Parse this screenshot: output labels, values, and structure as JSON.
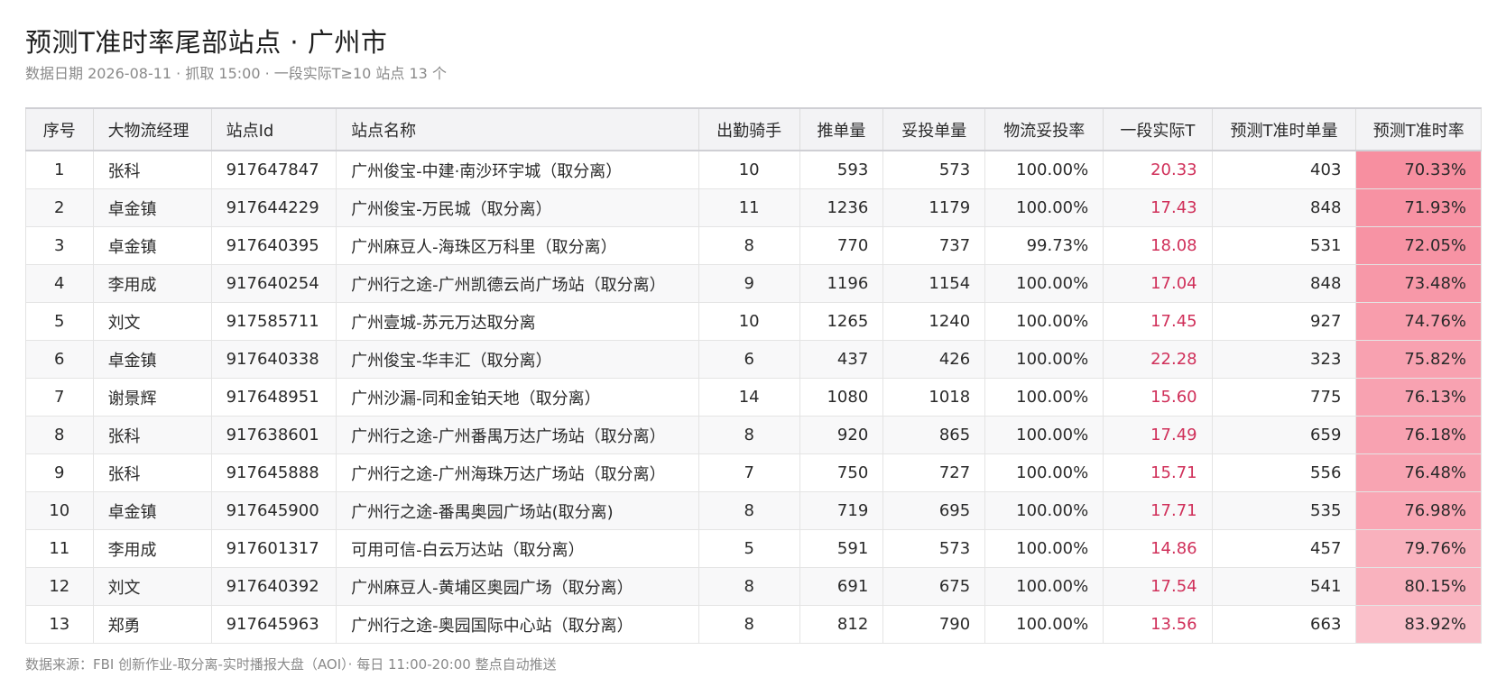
{
  "header": {
    "title": "预测T准时率尾部站点 · 广州市",
    "subtitle": "数据日期 2026-08-11 · 抓取 15:00 · 一段实际T≥10 站点 13 个"
  },
  "table": {
    "columns": [
      "序号",
      "大物流经理",
      "站点Id",
      "站点名称",
      "出勤骑手",
      "推单量",
      "妥投单量",
      "物流妥投率",
      "一段实际T",
      "预测T准时单量",
      "预测T准时率"
    ],
    "rows": [
      [
        "1",
        "张科",
        "917647847",
        "广州俊宝-中建·南沙环宇城（取分离）",
        "10",
        "593",
        "573",
        "100.00%",
        "20.33",
        "403",
        "70.33%"
      ],
      [
        "2",
        "卓金镇",
        "917644229",
        "广州俊宝-万民城（取分离）",
        "11",
        "1236",
        "1179",
        "100.00%",
        "17.43",
        "848",
        "71.93%"
      ],
      [
        "3",
        "卓金镇",
        "917640395",
        "广州麻豆人-海珠区万科里（取分离）",
        "8",
        "770",
        "737",
        "99.73%",
        "18.08",
        "531",
        "72.05%"
      ],
      [
        "4",
        "李用成",
        "917640254",
        "广州行之途-广州凯德云尚广场站（取分离）",
        "9",
        "1196",
        "1154",
        "100.00%",
        "17.04",
        "848",
        "73.48%"
      ],
      [
        "5",
        "刘文",
        "917585711",
        "广州壹城-苏元万达取分离",
        "10",
        "1265",
        "1240",
        "100.00%",
        "17.45",
        "927",
        "74.76%"
      ],
      [
        "6",
        "卓金镇",
        "917640338",
        "广州俊宝-华丰汇（取分离）",
        "6",
        "437",
        "426",
        "100.00%",
        "22.28",
        "323",
        "75.82%"
      ],
      [
        "7",
        "谢景辉",
        "917648951",
        "广州沙漏-同和金铂天地（取分离）",
        "14",
        "1080",
        "1018",
        "100.00%",
        "15.60",
        "775",
        "76.13%"
      ],
      [
        "8",
        "张科",
        "917638601",
        "广州行之途-广州番禺万达广场站（取分离）",
        "8",
        "920",
        "865",
        "100.00%",
        "17.49",
        "659",
        "76.18%"
      ],
      [
        "9",
        "张科",
        "917645888",
        "广州行之途-广州海珠万达广场站（取分离）",
        "7",
        "750",
        "727",
        "100.00%",
        "15.71",
        "556",
        "76.48%"
      ],
      [
        "10",
        "卓金镇",
        "917645900",
        "广州行之途-番禺奥园广场站(取分离)",
        "8",
        "719",
        "695",
        "100.00%",
        "17.71",
        "535",
        "76.98%"
      ],
      [
        "11",
        "李用成",
        "917601317",
        "可用可信-白云万达站（取分离）",
        "5",
        "591",
        "573",
        "100.00%",
        "14.86",
        "457",
        "79.76%"
      ],
      [
        "12",
        "刘文",
        "917640392",
        "广州麻豆人-黄埔区奥园广场（取分离）",
        "8",
        "691",
        "675",
        "100.00%",
        "17.54",
        "541",
        "80.15%"
      ],
      [
        "13",
        "郑勇",
        "917645963",
        "广州行之途-奥园国际中心站（取分离）",
        "8",
        "812",
        "790",
        "100.00%",
        "13.56",
        "663",
        "83.92%"
      ]
    ],
    "rate_colors": [
      "#f78fa0",
      "#f792a3",
      "#f793a4",
      "#f798a8",
      "#f89dac",
      "#f8a1b0",
      "#f8a2b1",
      "#f8a2b1",
      "#f8a4b2",
      "#f9a6b4",
      "#f9b1bd",
      "#f9b2be",
      "#fac0ca"
    ],
    "accent_red": "#d0305a"
  },
  "footer": {
    "note": "数据来源：FBI 创新作业-取分离-实时播报大盘（AOI）· 每日 11:00-20:00 整点自动推送"
  }
}
